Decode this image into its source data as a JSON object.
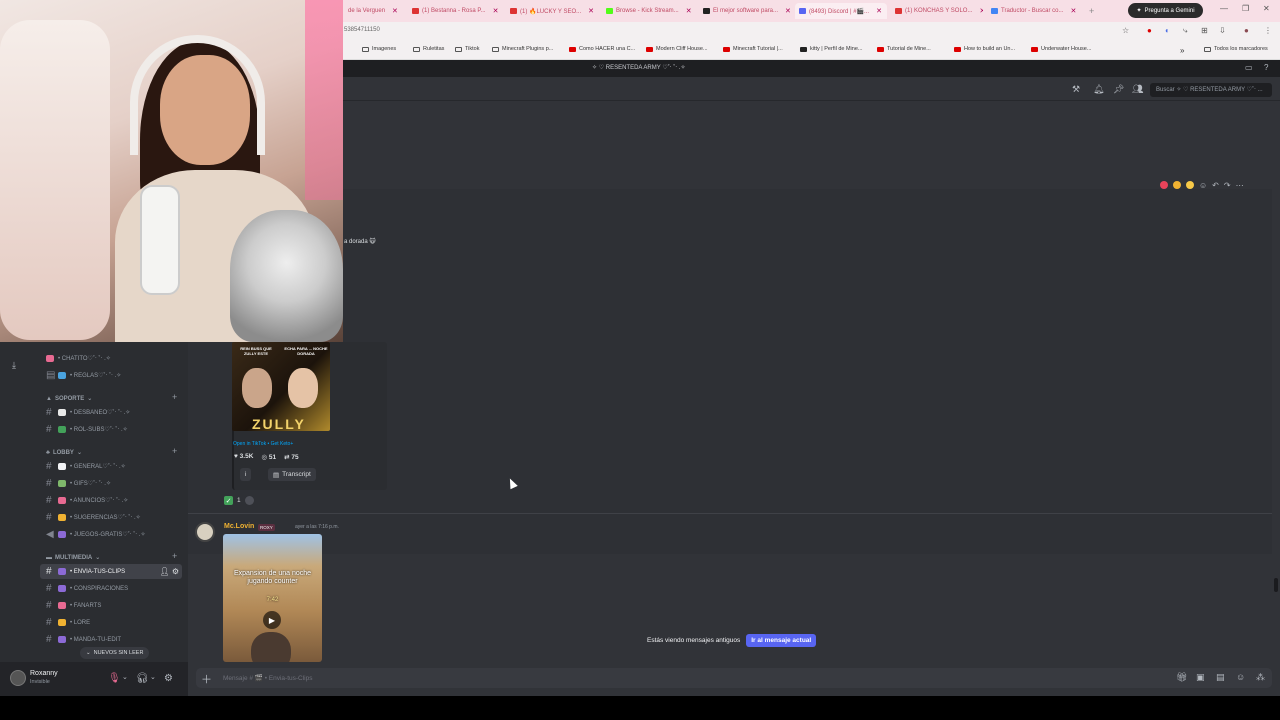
{
  "browser": {
    "tabs": [
      {
        "label": "de la Verguen",
        "color": "#d33"
      },
      {
        "label": "(1) Bestanna - Rosa P...",
        "color": "#d33"
      },
      {
        "label": "(1) 🔥LUCKY Y SEO...",
        "color": "#d33"
      },
      {
        "label": "Browse - Kick Stream...",
        "color": "#53fc18"
      },
      {
        "label": "El mejor software para...",
        "color": "#222"
      },
      {
        "label": "(8493) Discord | #🎬...",
        "color": "#5865f2"
      },
      {
        "label": "(1) KONCHAS Y SOLO...",
        "color": "#d33"
      },
      {
        "label": "Traductor - Buscar co...",
        "color": "#4285f4"
      }
    ],
    "gemini_label": "Pregunta a Gemini",
    "url": "53854711150",
    "bookmarks": [
      {
        "label": "Imagenes",
        "type": "folder"
      },
      {
        "label": "Ruletitas",
        "type": "folder"
      },
      {
        "label": "Tiktok",
        "type": "folder"
      },
      {
        "label": "Minecraft Plugins p...",
        "type": "folder"
      },
      {
        "label": "Como HACER una C...",
        "type": "yt"
      },
      {
        "label": "Modern Cliff House...",
        "type": "yt"
      },
      {
        "label": "Minecraft Tutorial |...",
        "type": "yt"
      },
      {
        "label": "kitty | Perfil de Mine...",
        "type": "site"
      },
      {
        "label": "Tutorial de Mine...",
        "type": "yt"
      },
      {
        "label": "How to build an Un...",
        "type": "yt"
      },
      {
        "label": "Underwater House...",
        "type": "yt"
      }
    ],
    "all_bookmarks": "Todos los marcadores"
  },
  "discord": {
    "server_title": "✧ ♡ RESENTEDA ARMY ♡˚‧ ˚‧ .✧",
    "search_placeholder": "Buscar ✧ ♡ RESENTEDA ARMY ♡˚‧ ...",
    "sidebar": {
      "categories": [
        {
          "label": "SOPORTE",
          "icon": "🌲"
        },
        {
          "label": "LOBBY",
          "icon": "🌴"
        },
        {
          "label": "MULTIMEDIA",
          "icon": "📼"
        }
      ],
      "channels": [
        {
          "label": "• CHATITO♡˚‧ ˚‧ .✧",
          "emoji_color": "#e86a92"
        },
        {
          "label": "• REGLAS♡˚‧ ˚‧ .✧",
          "emoji_color": "#4aa3df"
        },
        {
          "label": "• DESBANEO♡˚‧ ˚‧ .✧",
          "emoji_color": "#e8e8e8"
        },
        {
          "label": "• ROL-SUBS♡˚‧ ˚‧ .✧",
          "emoji_color": "#43a25a"
        },
        {
          "label": "• GENERAL♡˚‧ ˚‧ .✧",
          "emoji_color": "#f2f3f5"
        },
        {
          "label": "• GIFS♡˚‧ ˚‧ .✧",
          "emoji_color": "#7fb86b"
        },
        {
          "label": "• ANUNCIOS♡˚‧ ˚‧ .✧",
          "emoji_color": "#e86a92"
        },
        {
          "label": "• SUGERENCIAS♡˚‧ ˚‧ .✧",
          "emoji_color": "#f0b232"
        },
        {
          "label": "• JUEGOS-GRATIS♡˚‧ ˚‧ .✧",
          "emoji_color": "#8c6ad6"
        },
        {
          "label": "• ENVIA-TUS-CLIPS",
          "emoji_color": "#8c6ad6"
        },
        {
          "label": "• CONSPIRACIONES",
          "emoji_color": "#8c6ad6"
        },
        {
          "label": "• FANARTS",
          "emoji_color": "#e86a92"
        },
        {
          "label": "• LORE",
          "emoji_color": "#f0b232"
        },
        {
          "label": "• MANDA-TU-EDIT",
          "emoji_color": "#8c6ad6"
        }
      ],
      "new_unread": "NUEVOS SIN LEER"
    },
    "user": {
      "name": "Roxanny",
      "status": "Invisible"
    },
    "message1": {
      "text_fragment": "a dorada 🙀",
      "tiktok_open": "Open in TikTok • Get Keto+",
      "likes": "3.5K",
      "comments": "51",
      "shares": "75",
      "info_button": "i",
      "transcript_button": "Transcript",
      "thumb_caption_left": "REIN BUSS QUE ZULLY ESTE",
      "thumb_caption_right": "ECHA PARA ... NOCHE DORADA",
      "thumb_big_text": "ZULLY",
      "reaction_count": "1"
    },
    "message2": {
      "author": "Mc.Lovin",
      "tag": "ROXY",
      "timestamp": "ayer a las 7:16 p.m.",
      "video_text": "Expansion de una noche jugando counter",
      "video_time": "7:42"
    },
    "old_messages_banner": "Estás viendo mensajes antiguos",
    "jump_button": "Ir al mensaje actual",
    "composer_placeholder": "Mensaje # 🎬 • Envia-tus-Clips"
  },
  "colors": {
    "discord_bg": "#313338",
    "sidebar_bg": "#2b2d31",
    "accent": "#5865f2",
    "tab_bar": "#f7dfe6"
  }
}
